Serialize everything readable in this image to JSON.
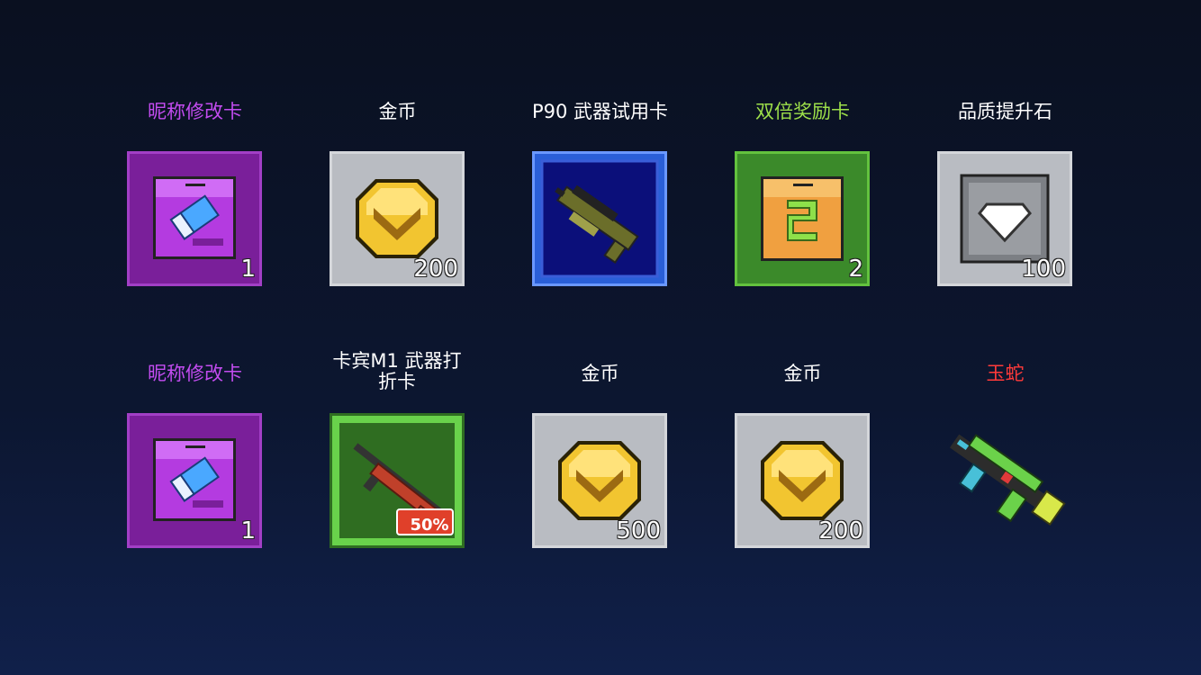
{
  "rewards": [
    {
      "label": "昵称修改卡",
      "label_color": "#c34cf0",
      "count": "1",
      "icon": "eraser-card-icon",
      "tile": "purple"
    },
    {
      "label": "金币",
      "label_color": "#ffffff",
      "count": "200",
      "icon": "gold-coin-icon",
      "tile": "gray"
    },
    {
      "label": "P90 武器试用卡",
      "label_color": "#ffffff",
      "count": "",
      "icon": "p90-gun-icon",
      "tile": "blue"
    },
    {
      "label": "双倍奖励卡",
      "label_color": "#9de04a",
      "count": "2",
      "icon": "double-reward-card-icon",
      "tile": "green"
    },
    {
      "label": "品质提升石",
      "label_color": "#ffffff",
      "count": "100",
      "icon": "diamond-stone-icon",
      "tile": "gray"
    },
    {
      "label": "昵称修改卡",
      "label_color": "#c34cf0",
      "count": "1",
      "icon": "eraser-card-icon",
      "tile": "purple"
    },
    {
      "label": "卡宾M1 武器打折卡",
      "label_color": "#ffffff",
      "count": "",
      "icon": "m1-carbine-icon",
      "tile": "lightgreen",
      "badge": "50%"
    },
    {
      "label": "金币",
      "label_color": "#ffffff",
      "count": "500",
      "icon": "gold-coin-icon",
      "tile": "gray"
    },
    {
      "label": "金币",
      "label_color": "#ffffff",
      "count": "200",
      "icon": "gold-coin-icon",
      "tile": "gray"
    },
    {
      "label": "玉蛇",
      "label_color": "#ff3a3a",
      "count": "",
      "icon": "jade-snake-gun-icon",
      "tile": "none"
    }
  ]
}
